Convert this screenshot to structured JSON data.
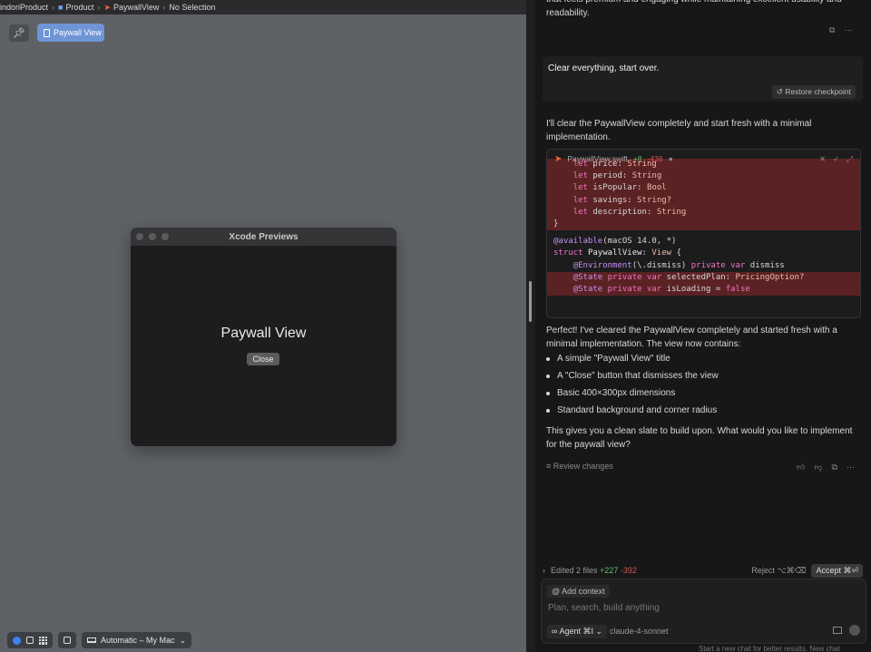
{
  "breadcrumb": {
    "items": [
      "indoriProduct",
      "Product",
      "PaywallView",
      "No Selection"
    ]
  },
  "canvas_toolbar": {
    "pin_icon": "pin-icon",
    "preview_tab_label": "Paywall View"
  },
  "preview_window": {
    "title": "Xcode Previews",
    "content_title": "Paywall View",
    "close_label": "Close"
  },
  "bottom_toolbar": {
    "device_label": "Automatic – My Mac"
  },
  "chat": {
    "intro_text": "that feels premium and engaging while maintaining excellent usability and readability.",
    "user_message": "Clear everything, start over.",
    "restore_label": "Restore checkpoint",
    "assistant_intro": "I'll clear the PaywallView completely and start fresh with a minimal implementation.",
    "code_file": "PaywallView.swift",
    "code_added": "+8",
    "code_removed": "-436",
    "summary": "Perfect! I've cleared the PaywallView completely and started fresh with a minimal implementation. The view now contains:",
    "bullets": [
      "A simple \"Paywall View\" title",
      "A \"Close\" button that dismisses the view",
      "Basic 400×300px dimensions",
      "Standard background and corner radius"
    ],
    "closing": "This gives you a clean slate to build upon. What would you like to implement for the paywall view?",
    "review_label": "Review changes",
    "edited_label": "Edited 2 files",
    "edited_added": "+227",
    "edited_removed": "-392",
    "reject_label": "Reject ⌥⌘⌫",
    "accept_label": "Accept ⌘⏎",
    "add_context_label": "Add context",
    "input_placeholder": "Plan, search, build anything",
    "agent_label": "Agent ⌘I",
    "model_label": "claude-4-sonnet",
    "footer_text": "Start a new chat for better results.   New chat"
  },
  "colors": {
    "accent": "#6f95d6",
    "diff_removed_bg": "#5b2224",
    "warning": "#e6c22c"
  }
}
